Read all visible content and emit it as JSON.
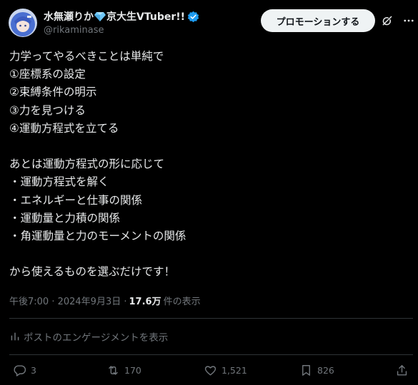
{
  "author": {
    "display_name_prefix": "水無瀬りか",
    "display_name_suffix": "京大生VTuber!!",
    "handle": "@rikaminase",
    "verified": true
  },
  "header": {
    "promote_label": "プロモーションする"
  },
  "post": {
    "lines": [
      "力学ってやるべきことは単純で",
      "①座標系の設定",
      "②束縛条件の明示",
      "③力を見つける",
      "④運動方程式を立てる",
      "",
      "あとは運動方程式の形に応じて",
      "・運動方程式を解く",
      "・エネルギーと仕事の関係",
      "・運動量と力積の関係",
      "・角運動量と力のモーメントの関係",
      "",
      "から使えるものを選ぶだけです！"
    ]
  },
  "meta": {
    "time": "午後7:00 · 2024年9月3日 ·",
    "views": "17.6万",
    "views_label": "件の表示"
  },
  "engagements_label": "ポストのエンゲージメントを表示",
  "actions": {
    "replies": "3",
    "reposts": "170",
    "likes": "1,521",
    "bookmarks": "826"
  },
  "colors": {
    "background": "#000000",
    "text": "#e7e9ea",
    "secondary": "#71767b",
    "verified": "#1d9bf0",
    "divider": "#2f3336"
  }
}
